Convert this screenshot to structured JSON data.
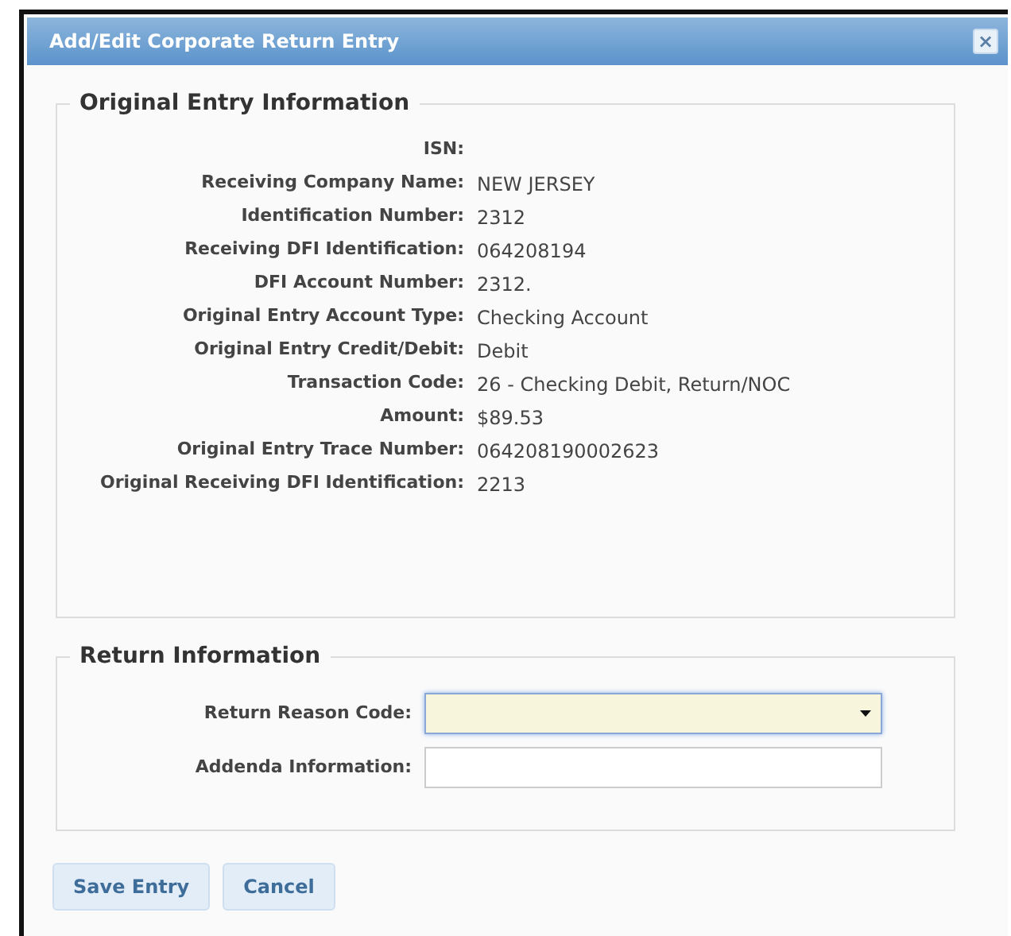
{
  "window": {
    "title": "Add/Edit Corporate Return Entry",
    "close": "×"
  },
  "original_entry": {
    "legend": "Original Entry Information",
    "rows": [
      {
        "label": "ISN:"
      },
      {
        "label": "Receiving Company Name:",
        "value": "NEW JERSEY"
      },
      {
        "label": "Identification Number:",
        "value": "2312"
      },
      {
        "label": "Receiving DFI Identification:",
        "value": "064208194"
      },
      {
        "label": "DFI Account Number:",
        "value": "2312."
      },
      {
        "label": "Original Entry Account Type:",
        "value": "Checking Account"
      },
      {
        "label": "Original Entry Credit/Debit:",
        "value": "Debit"
      },
      {
        "label": "Transaction Code:",
        "value": "26 - Checking Debit, Return/NOC"
      },
      {
        "label": "Amount:",
        "value": "$89.53"
      },
      {
        "label": "Original Entry Trace Number:",
        "value": "064208190002623"
      },
      {
        "label": "Original Receiving DFI Identification:",
        "value": "2213"
      }
    ]
  },
  "return_info": {
    "legend": "Return Information",
    "fields": [
      {
        "label": "Return Reason Code:",
        "kind": "dropdown",
        "focused": true
      },
      {
        "label": "Addenda Information:",
        "kind": "text",
        "focused": false
      }
    ]
  },
  "buttons": [
    "Save Entry",
    "Cancel"
  ]
}
